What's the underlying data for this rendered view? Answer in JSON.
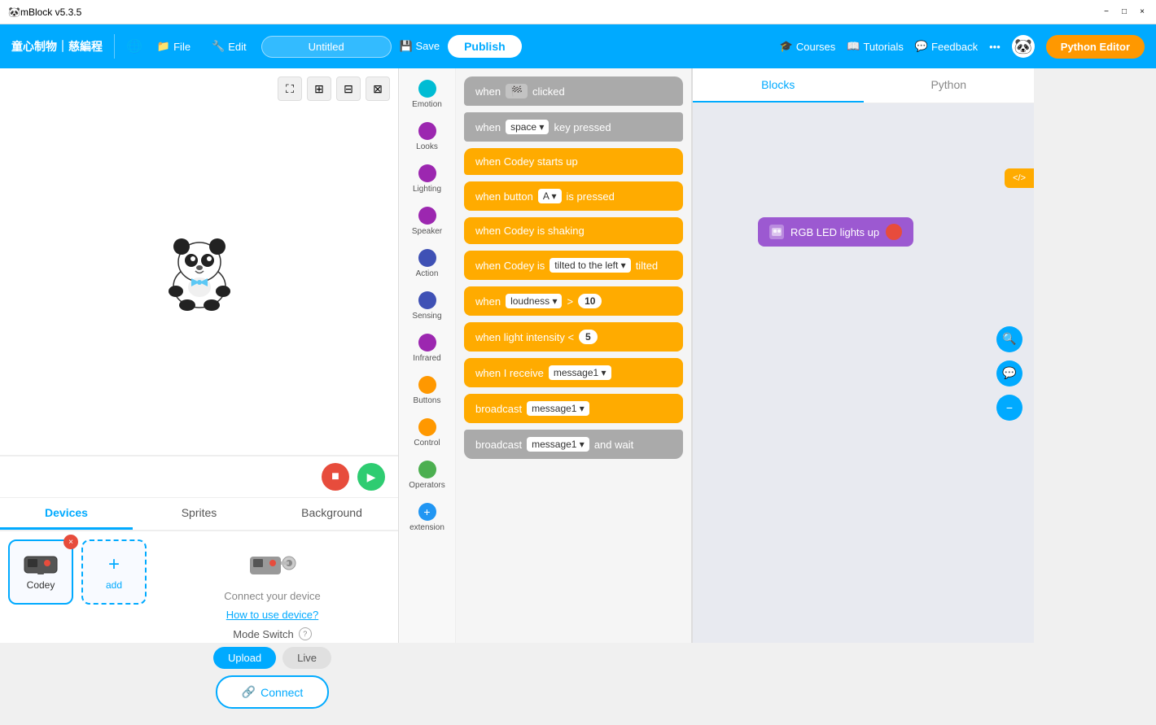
{
  "titleBar": {
    "appName": "mBlock v5.3.5",
    "minimize": "−",
    "maximize": "□",
    "close": "×"
  },
  "topNav": {
    "brand": "童心制物｜慈編程",
    "globeIcon": "🌐",
    "fileLabel": "File",
    "editLabel": "Edit",
    "projectName": "Untitled",
    "saveLabel": "💾 Save",
    "publishLabel": "Publish",
    "coursesLabel": "Courses",
    "tutorialsLabel": "Tutorials",
    "feedbackLabel": "Feedback",
    "moreLabel": "•••",
    "pythonEditorLabel": "Python Editor"
  },
  "stageControls": [
    {
      "icon": "⛶",
      "name": "fullscreen"
    },
    {
      "icon": "⊞",
      "name": "grid-view-2"
    },
    {
      "icon": "⊟",
      "name": "grid-view-3"
    },
    {
      "icon": "⊠",
      "name": "grid-view-4"
    }
  ],
  "stageActionBtns": {
    "stop": "■",
    "run": "▶"
  },
  "bottomTabs": [
    {
      "label": "Devices",
      "id": "devices",
      "active": true
    },
    {
      "label": "Sprites",
      "id": "sprites",
      "active": false
    },
    {
      "label": "Background",
      "id": "background",
      "active": false
    }
  ],
  "deviceSection": {
    "deviceName": "Codey",
    "addLabel": "add",
    "connectLabel": "Connect your device",
    "howToUseLink": "How to use device?",
    "modeSwitchLabel": "Mode Switch",
    "uploadLabel": "Upload",
    "liveLabel": "Live",
    "connectBtnLabel": "Connect"
  },
  "blockCategories": [
    {
      "label": "Emotion",
      "color": "#00bcd4"
    },
    {
      "label": "Looks",
      "color": "#9c27b0"
    },
    {
      "label": "Lighting",
      "color": "#9c27b0"
    },
    {
      "label": "Speaker",
      "color": "#9c27b0"
    },
    {
      "label": "Action",
      "color": "#3f51b5"
    },
    {
      "label": "Sensing",
      "color": "#3f51b5"
    },
    {
      "label": "Infrared",
      "color": "#9c27b0"
    },
    {
      "label": "Buttons",
      "color": "#ff9800"
    },
    {
      "label": "Control",
      "color": "#ff9800"
    },
    {
      "label": "Operators",
      "color": "#4caf50"
    },
    {
      "label": "extension",
      "color": "#2196f3"
    }
  ],
  "blocks": [
    {
      "type": "gray",
      "text": "when 🏁 clicked",
      "id": "when-flag-clicked"
    },
    {
      "type": "gray",
      "text": "when space ▾ key pressed",
      "id": "when-key-pressed"
    },
    {
      "type": "yellow",
      "text": "when Codey starts up",
      "id": "when-codey-starts"
    },
    {
      "type": "yellow",
      "text": "when button A ▾ is pressed",
      "id": "when-button-pressed"
    },
    {
      "type": "yellow",
      "text": "when Codey is shaking",
      "id": "when-shaking"
    },
    {
      "type": "yellow",
      "text": "when Codey is tilted to the left ▾ tilted",
      "id": "when-tilted"
    },
    {
      "type": "yellow",
      "text": "when loudness ▾ > 10",
      "id": "when-loudness"
    },
    {
      "type": "yellow",
      "text": "when light intensity < 5",
      "id": "when-light-intensity"
    },
    {
      "type": "yellow",
      "text": "when I receive message1 ▾",
      "id": "when-receive"
    },
    {
      "type": "yellow",
      "text": "broadcast message1 ▾",
      "id": "broadcast"
    },
    {
      "type": "gray",
      "text": "broadcast message1 ▾ and wait",
      "id": "broadcast-wait"
    }
  ],
  "rightPanel": {
    "blocksTabLabel": "Blocks",
    "pythonTabLabel": "Python",
    "rgbBlockLabel": "RGB LED lights up",
    "codeToggleLabel": "</>",
    "actionBtns": {
      "search": "🔍",
      "comment": "💬",
      "minus": "−"
    }
  }
}
